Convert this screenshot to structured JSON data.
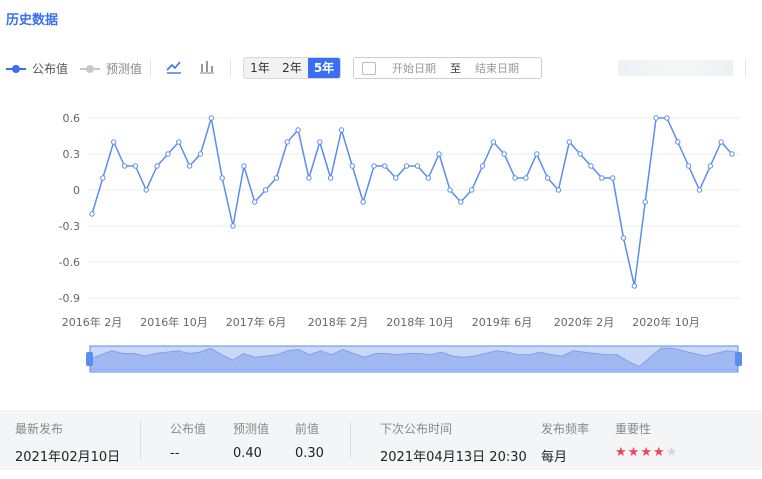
{
  "header": {
    "title": "历史数据"
  },
  "toolbar": {
    "legend_published": "公布值",
    "legend_forecast": "预测值",
    "ranges": [
      "1年",
      "2年",
      "5年"
    ],
    "active_range": "5年",
    "start_placeholder": "开始日期",
    "to_label": "至",
    "end_placeholder": "结束日期",
    "accent_color": "#3a6ff5",
    "forecast_color": "#c8c8c8"
  },
  "chart_data": {
    "type": "line",
    "x_ticks": [
      "2016年 2月",
      "2016年 10月",
      "2017年 6月",
      "2018年 2月",
      "2018年 10月",
      "2019年 6月",
      "2020年 2月",
      "2020年 10月"
    ],
    "yticks": [
      "0.6",
      "0.3",
      "0",
      "-0.3",
      "-0.6",
      "-0.9"
    ],
    "ylim": [
      -0.9,
      0.6
    ],
    "grid": true,
    "series": [
      {
        "values": [
          -0.2,
          0.1,
          0.4,
          0.2,
          0.2,
          0.0,
          0.2,
          0.3,
          0.4,
          0.2,
          0.3,
          0.6,
          0.1,
          -0.3,
          0.2,
          -0.1,
          0.0,
          0.1,
          0.4,
          0.5,
          0.1,
          0.4,
          0.1,
          0.5,
          0.2,
          -0.1,
          0.2,
          0.2,
          0.1,
          0.2,
          0.2,
          0.1,
          0.3,
          0.0,
          -0.1,
          0.0,
          0.2,
          0.4,
          0.3,
          0.1,
          0.1,
          0.3,
          0.1,
          0.0,
          0.4,
          0.3,
          0.2,
          0.1,
          0.1,
          -0.4,
          -0.8,
          -0.1,
          0.6,
          0.6,
          0.4,
          0.2,
          0.0,
          0.2,
          0.4,
          0.3
        ]
      }
    ],
    "line_color": "#5b8def"
  },
  "summary": {
    "latest_label": "最新发布",
    "latest_value": "2021年02月10日",
    "published_label": "公布值",
    "published_value": "--",
    "forecast_label": "预测值",
    "forecast_value": "0.40",
    "previous_label": "前值",
    "previous_value": "0.30",
    "next_label": "下次公布时间",
    "next_value": "2021年04月13日 20:30",
    "freq_label": "发布频率",
    "freq_value": "每月",
    "importance_label": "重要性",
    "importance_stars": 4,
    "importance_max": 5,
    "star_color": "#f0435a"
  }
}
